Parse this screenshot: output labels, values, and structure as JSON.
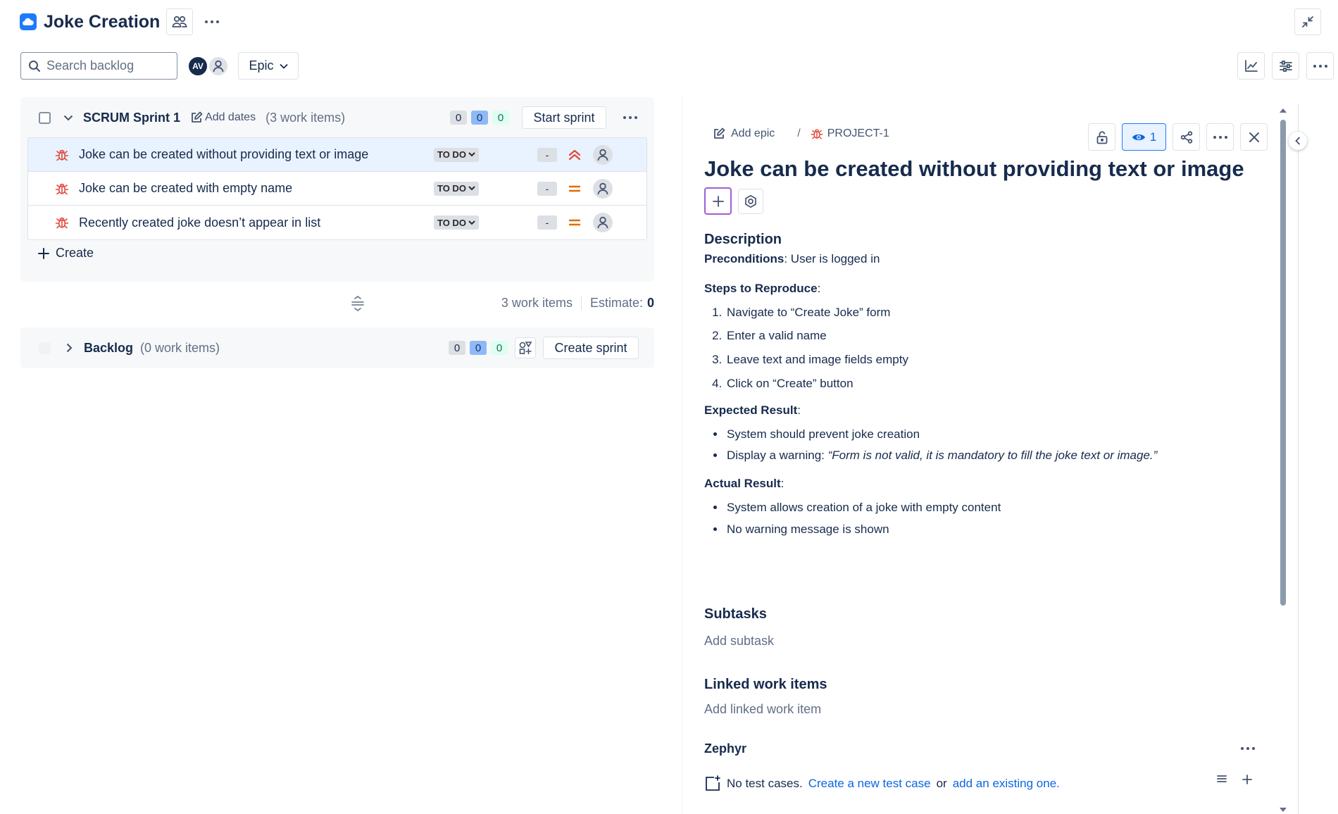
{
  "header": {
    "title": "Joke Creation",
    "brand_color": "#1d7afc"
  },
  "toolbar": {
    "search_placeholder": "Search backlog",
    "avatar_initials": "AV",
    "epic_filter_label": "Epic"
  },
  "sprint": {
    "name": "SCRUM Sprint 1",
    "add_dates_label": "Add dates",
    "count_label": "(3 work items)",
    "counts": {
      "todo": "0",
      "in_progress": "0",
      "done": "0"
    },
    "start_button": "Start sprint",
    "issues": [
      {
        "title": "Joke can be created without providing text or image",
        "status": "TO DO",
        "estimate": "-",
        "priority": "highest"
      },
      {
        "title": "Joke can be created with empty name",
        "status": "TO DO",
        "estimate": "-",
        "priority": "medium"
      },
      {
        "title": "Recently created joke doesn’t appear in list",
        "status": "TO DO",
        "estimate": "-",
        "priority": "medium"
      }
    ],
    "create_label": "Create",
    "summary_items": "3 work items",
    "summary_estimate_label": "Estimate:",
    "summary_estimate_value": "0"
  },
  "backlog": {
    "name": "Backlog",
    "count_label": "(0 work items)",
    "counts": {
      "todo": "0",
      "in_progress": "0",
      "done": "0"
    },
    "create_sprint_button": "Create sprint"
  },
  "detail": {
    "add_epic_label": "Add epic",
    "issue_key": "PROJECT-1",
    "watch_count": "1",
    "title": "Joke can be created without providing text or image",
    "description": {
      "heading": "Description",
      "preconditions_label": "Preconditions",
      "preconditions_text": ": User is logged in",
      "steps_label": "Steps to Reproduce",
      "steps_suffix": ":",
      "steps": [
        "Navigate to “Create Joke” form",
        "Enter a valid name",
        "Leave text and image fields empty",
        "Click on “Create” button"
      ],
      "expected_label": "Expected Result",
      "expected_suffix": ":",
      "expected_item1": "System should prevent joke creation",
      "expected_item2_prefix": "Display a warning: ",
      "expected_item2_quote": "“Form is not valid, it is mandatory to fill the joke text or image.”",
      "actual_label": "Actual Result",
      "actual_suffix": ":",
      "actual": [
        "System allows creation of a joke with empty content",
        "No warning message is shown"
      ]
    },
    "subtasks_heading": "Subtasks",
    "add_subtask": "Add subtask",
    "linked_heading": "Linked work items",
    "add_linked": "Add linked work item",
    "zephyr_heading": "Zephyr",
    "zephyr_no_cases": "No test cases.",
    "zephyr_create_link": "Create a new test case",
    "zephyr_or": "or",
    "zephyr_add_link": "add an existing one."
  },
  "colors": {
    "bug_red": "#e2483d",
    "priority_high": "#e2483d",
    "priority_medium": "#e06c00",
    "link_blue": "#0c66e4",
    "focus_purple": "#9f5fd6"
  }
}
